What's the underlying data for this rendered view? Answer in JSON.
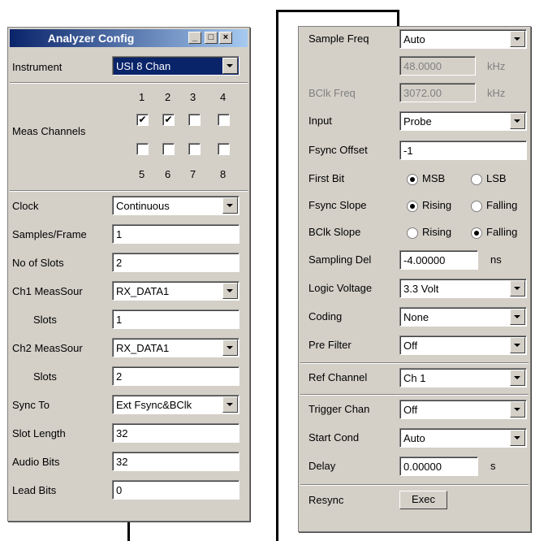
{
  "left": {
    "title": "Analyzer Config",
    "instrument": {
      "label": "Instrument",
      "value": "USI 8 Chan"
    },
    "meas_channels": {
      "label": "Meas Channels",
      "top_nums": [
        "1",
        "2",
        "3",
        "4"
      ],
      "bottom_nums": [
        "5",
        "6",
        "7",
        "8"
      ],
      "checked": [
        true,
        true,
        false,
        false,
        false,
        false,
        false,
        false
      ]
    },
    "clock": {
      "label": "Clock",
      "value": "Continuous"
    },
    "samples_frame": {
      "label": "Samples/Frame",
      "value": "1"
    },
    "no_of_slots": {
      "label": "No of Slots",
      "value": "2"
    },
    "ch1_meassour": {
      "label": "Ch1 MeasSour",
      "value": "RX_DATA1"
    },
    "ch1_slots": {
      "label": "Slots",
      "value": "1"
    },
    "ch2_meassour": {
      "label": "Ch2 MeasSour",
      "value": "RX_DATA1"
    },
    "ch2_slots": {
      "label": "Slots",
      "value": "2"
    },
    "sync_to": {
      "label": "Sync To",
      "value": "Ext Fsync&BClk"
    },
    "slot_length": {
      "label": "Slot Length",
      "value": "32"
    },
    "audio_bits": {
      "label": "Audio Bits",
      "value": "32"
    },
    "lead_bits": {
      "label": "Lead Bits",
      "value": "0"
    }
  },
  "right": {
    "sample_freq": {
      "label": "Sample Freq",
      "value": "Auto",
      "sub_value": "48.0000",
      "unit": "kHz"
    },
    "bclk_freq": {
      "label": "BClk Freq",
      "value": "3072.00",
      "unit": "kHz"
    },
    "input": {
      "label": "Input",
      "value": "Probe"
    },
    "fsync_offset": {
      "label": "Fsync Offset",
      "value": "-1"
    },
    "first_bit": {
      "label": "First Bit",
      "opt1": "MSB",
      "opt2": "LSB",
      "selected": "MSB"
    },
    "fsync_slope": {
      "label": "Fsync Slope",
      "opt1": "Rising",
      "opt2": "Falling",
      "selected": "Rising"
    },
    "bclk_slope": {
      "label": "BClk Slope",
      "opt1": "Rising",
      "opt2": "Falling",
      "selected": "Falling"
    },
    "sampling_del": {
      "label": "Sampling Del",
      "value": "-4.00000",
      "unit": "ns"
    },
    "logic_voltage": {
      "label": "Logic Voltage",
      "value": "3.3 Volt"
    },
    "coding": {
      "label": "Coding",
      "value": "None"
    },
    "pre_filter": {
      "label": "Pre Filter",
      "value": "Off"
    },
    "ref_channel": {
      "label": "Ref Channel",
      "value": "Ch 1"
    },
    "trigger_chan": {
      "label": "Trigger Chan",
      "value": "Off"
    },
    "start_cond": {
      "label": "Start Cond",
      "value": "Auto"
    },
    "delay": {
      "label": "Delay",
      "value": "0.00000",
      "unit": "s"
    },
    "resync": {
      "label": "Resync",
      "button": "Exec"
    }
  }
}
